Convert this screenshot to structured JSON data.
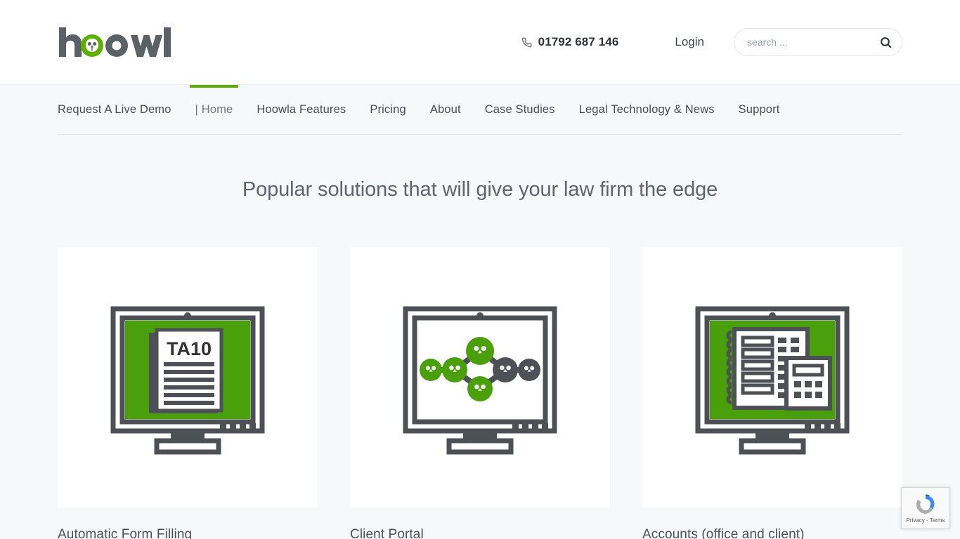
{
  "brand": {
    "name": "hoowla",
    "logo_alt": "hoowla-logo",
    "green": "#5bb000",
    "dark": "#5b6166"
  },
  "header": {
    "phone": "01792 687 146",
    "phone_icon": "phone-icon",
    "login_label": "Login",
    "search": {
      "placeholder": "search ...",
      "value": "",
      "icon": "search-icon"
    }
  },
  "nav": {
    "items": [
      {
        "label": "Request A Live Demo",
        "active": false
      },
      {
        "label": "| Home",
        "active": true
      },
      {
        "label": "Hoowla Features",
        "active": false
      },
      {
        "label": "Pricing",
        "active": false
      },
      {
        "label": "About",
        "active": false
      },
      {
        "label": "Case Studies",
        "active": false
      },
      {
        "label": "Legal Technology & News",
        "active": false
      },
      {
        "label": "Support",
        "active": false
      }
    ]
  },
  "main": {
    "section_title": "Popular solutions that will give your law firm the edge",
    "cards": [
      {
        "title": "Automatic Form Filling",
        "illustration": "monitor-document-ta10",
        "document_label": "TA10"
      },
      {
        "title": "Client Portal",
        "illustration": "monitor-workflow-nodes"
      },
      {
        "title": "Accounts (office and client)",
        "illustration": "monitor-ledger-calculator"
      }
    ]
  },
  "recaptcha": {
    "label": "Privacy - Terms",
    "logo": "recaptcha-logo"
  }
}
